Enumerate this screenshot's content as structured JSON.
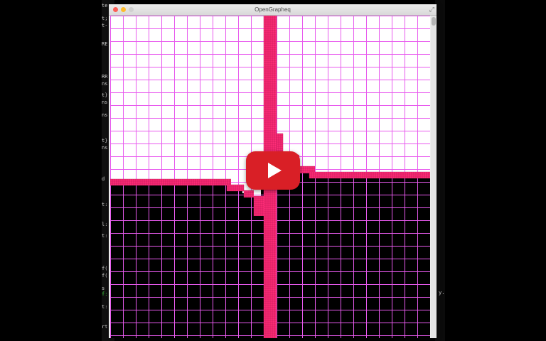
{
  "window": {
    "title": "OpenGrapheq",
    "fullscreen_icon": "fullscreen-icon"
  },
  "terminal_fragments": [
    {
      "text": "te",
      "green": false
    },
    {
      "text": "t;",
      "green": false
    },
    {
      "text": "t-",
      "green": false
    },
    {
      "text": "RE",
      "green": false
    },
    {
      "text": "RR",
      "green": false
    },
    {
      "text": "ns",
      "green": false
    },
    {
      "text": "t}",
      "green": false
    },
    {
      "text": "ns",
      "green": false
    },
    {
      "text": "ns",
      "green": false
    },
    {
      "text": "t}",
      "green": false
    },
    {
      "text": "ns",
      "green": false
    },
    {
      "text": "d",
      "green": false
    },
    {
      "text": "t:",
      "green": false
    },
    {
      "text": "l:",
      "green": false
    },
    {
      "text": "t:",
      "green": false
    },
    {
      "text": "f(",
      "green": false
    },
    {
      "text": "f(",
      "green": false
    },
    {
      "text": "s",
      "green": false
    },
    {
      "text": "f:",
      "green": true
    },
    {
      "text": "t:",
      "green": false
    },
    {
      "text": "rt",
      "green": false
    }
  ],
  "right_fragment": "y.",
  "colors": {
    "grid_line": "#e85aee",
    "boundary": "#ff2d78",
    "boundary_dark": "#b0124f",
    "light_fill": "#ffffff",
    "dark_fill": "#000000",
    "play_red": "#d91f26"
  },
  "play_button": {
    "icon": "play-icon"
  }
}
